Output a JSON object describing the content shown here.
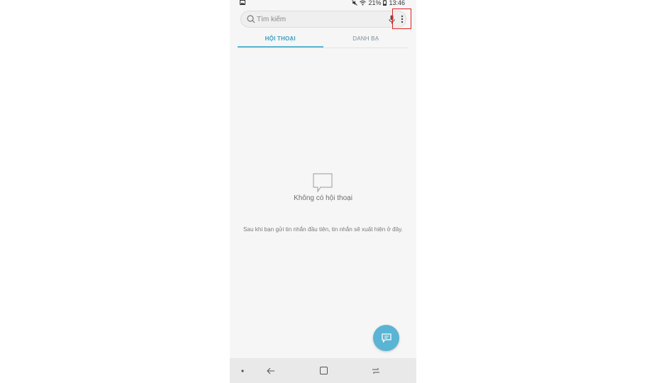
{
  "status_bar": {
    "battery": "21%",
    "time": "13:46"
  },
  "search": {
    "placeholder": "Tìm kiếm"
  },
  "tabs": [
    {
      "label": "HỘI THOẠI",
      "active": true
    },
    {
      "label": "DANH BẠ",
      "active": false
    }
  ],
  "empty_state": {
    "title": "Không có hội thoại",
    "description": "Sau khi bạn gửi tin nhắn đầu tiên, tin nhắn sẽ xuất hiện ở đây."
  },
  "icons": {
    "gallery": "gallery-icon",
    "mute": "mute-icon",
    "wifi": "wifi-icon",
    "battery": "battery-icon",
    "search": "search-icon",
    "mic": "mic-icon",
    "more": "more-vertical-icon",
    "empty": "chat-bubble-icon",
    "fab": "compose-message-icon",
    "nav_dot": "dot-icon",
    "nav_back": "back-arrow-icon",
    "nav_home": "home-square-icon",
    "nav_recents": "recents-icon"
  },
  "colors": {
    "accent": "#3a9fc0",
    "fab": "#5ab4d3",
    "highlight_box": "#e02020",
    "background": "#f6f6f6"
  }
}
